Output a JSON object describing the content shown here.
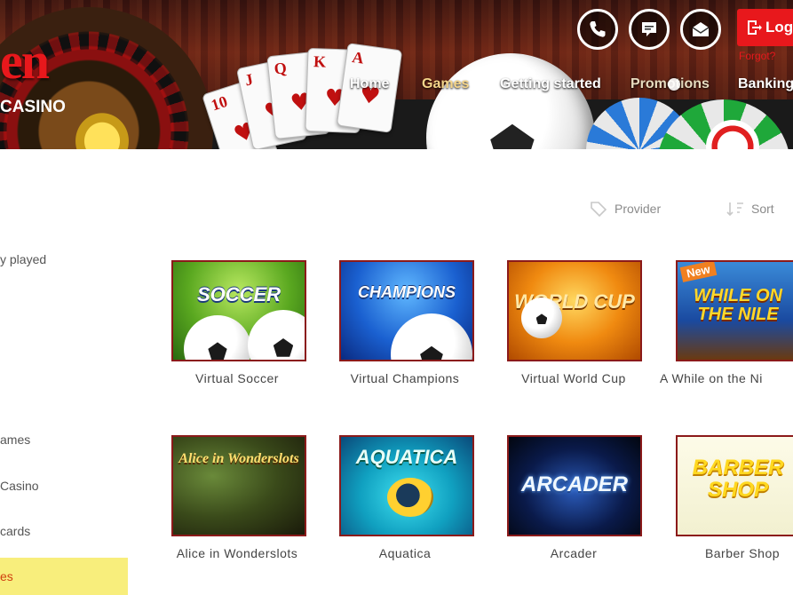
{
  "brand": {
    "logo_text": "en",
    "logo_sub": "CASINO"
  },
  "header": {
    "login_label": "Logi",
    "forgot_text": "Forgot?",
    "icons": [
      "phone-icon",
      "chat-icon",
      "mail-icon"
    ]
  },
  "nav": {
    "items": [
      "Home",
      "Games",
      "Getting started",
      "Promotions",
      "Banking"
    ],
    "active": "Games"
  },
  "toolbar": {
    "provider_label": "Provider",
    "sort_label": "Sort"
  },
  "sidebar": {
    "items": [
      "y played",
      "ames",
      "Casino",
      "cards",
      "es"
    ],
    "highlighted_index": 4
  },
  "games": {
    "row1": [
      {
        "title": "Virtual Soccer",
        "art": "SOCCER"
      },
      {
        "title": "Virtual Champions",
        "art": "CHAMPIONS"
      },
      {
        "title": "Virtual World Cup",
        "art": "WORLD CUP"
      },
      {
        "title": "A While on the Ni",
        "art": "WHILE ON THE NILE",
        "badge": "New"
      }
    ],
    "row2": [
      {
        "title": "Alice in Wonderslots",
        "art": "Alice in Wonderslots"
      },
      {
        "title": "Aquatica",
        "art": "AQUATICA"
      },
      {
        "title": "Arcader",
        "art": "ARCADER"
      },
      {
        "title": "Barber Shop",
        "art": "BARBER SHOP"
      }
    ]
  },
  "colors": {
    "brand_red": "#e8181c",
    "nav_active": "#f5d58a",
    "highlight_bg": "#f8ee7c",
    "tile_border": "#8b1a1a"
  }
}
